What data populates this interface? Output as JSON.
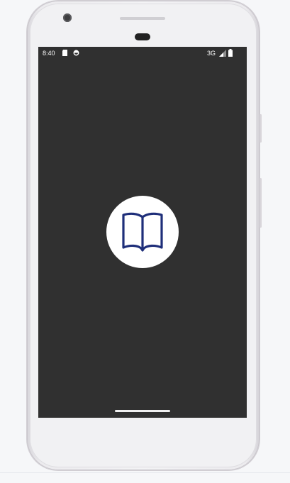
{
  "status_bar": {
    "time": "8:40",
    "network": "3G",
    "icons": [
      "sd-card-icon",
      "sync-icon",
      "signal-icon",
      "battery-icon"
    ]
  },
  "splash": {
    "logo_icon": "open-book-icon",
    "background_color": "#303030",
    "logo_circle_color": "#ffffff",
    "logo_color": "#1f2f7a"
  },
  "device": {
    "type": "android-phone-frame"
  }
}
